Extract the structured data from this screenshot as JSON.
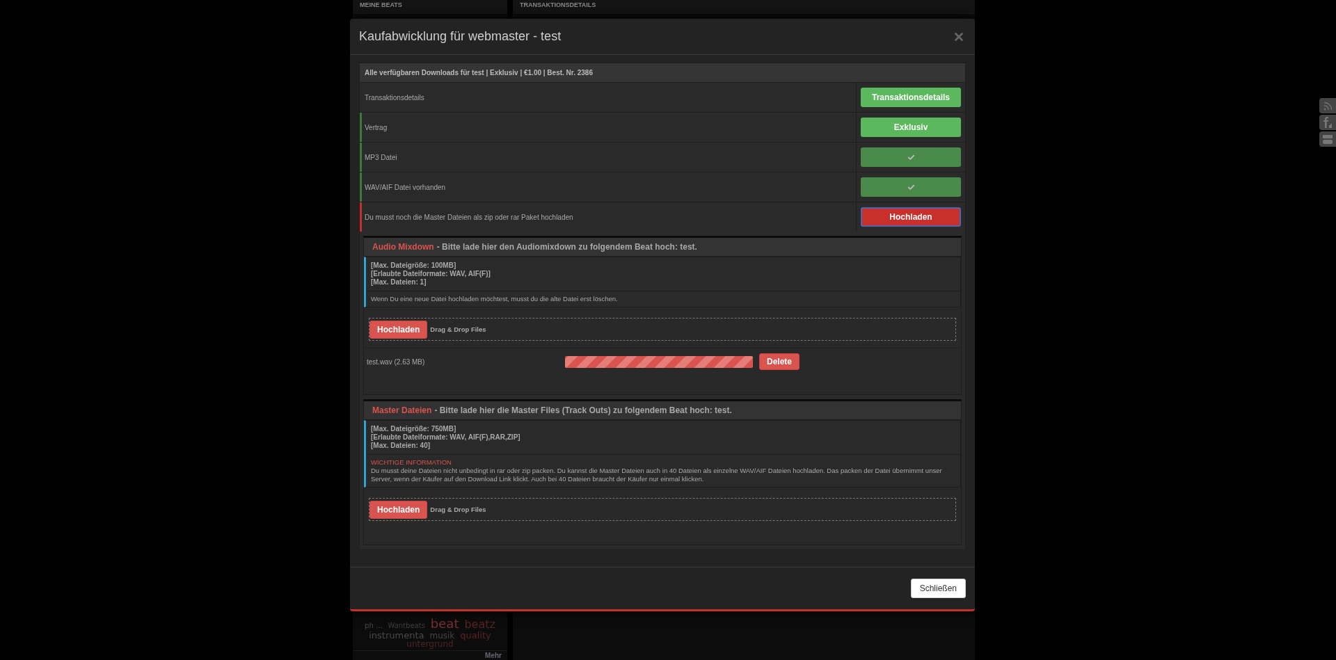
{
  "background": {
    "left_header": "MEINE BEATS",
    "right_header": "TRANSAKTIONSDETAILS",
    "tags": [
      {
        "text": "ph ...",
        "kind": "small",
        "color": "#4a4a4a"
      },
      {
        "text": "Wantbeats",
        "kind": "small",
        "color": "#3f3f3f"
      },
      {
        "text": "beat",
        "kind": "huge",
        "color": "#7a3030"
      },
      {
        "text": "beatz",
        "kind": "big",
        "color": "#5a2222"
      },
      {
        "text": "instrumenta",
        "kind": "medium",
        "color": "#4a4a4a"
      },
      {
        "text": "musik",
        "kind": "normal",
        "color": "#444444"
      },
      {
        "text": "quality",
        "kind": "medium",
        "color": "#5a2222"
      },
      {
        "text": "untergrund",
        "kind": "normal",
        "color": "#4f2424"
      }
    ],
    "more_link": "Mehr"
  },
  "modal": {
    "title": "Kaufabwicklung für webmaster - test",
    "summary": "Alle verfügbaren Downloads für test | Exklusiv | €1.00 | Best. Nr. 2386",
    "rows": [
      {
        "label": "Transaktionsdetails",
        "button": {
          "kind": "primary",
          "text": "Transaktionsdetails"
        }
      },
      {
        "label": "Vertrag",
        "color": "#3c7a3c",
        "button": {
          "kind": "primary",
          "text": "Exklusiv"
        }
      },
      {
        "label": "MP3 Datei",
        "color": "#3c7a3c",
        "button": {
          "kind": "done"
        }
      },
      {
        "label": "WAV/AIF Datei vorhanden",
        "color": "#3c7a3c",
        "button": {
          "kind": "done"
        }
      },
      {
        "label": "Du musst noch die Master Dateien als zip oder rar Paket hochladen",
        "color": "#c9302c",
        "button": {
          "kind": "danger",
          "text": "Hochladen"
        }
      }
    ],
    "sections": [
      {
        "title": "Audio Mixdown",
        "subtitle": "- Bitte lade hier den Audiomixdown zu folgendem Beat hoch: test.",
        "limits": [
          "[Max. Dateigröße: 100MB]",
          "[Erlaubte Dateiformate: WAV, AIF(F)]",
          "[Max. Dateien: 1]"
        ],
        "notice": {
          "text": "Wenn Du eine neue Datei hochladen möchtest, musst du die alte Datei erst löschen."
        },
        "upload_button": "Hochladen",
        "drop_hint": "Drag & Drop Files",
        "files": [
          {
            "name": "test.wav (2.63 MB)",
            "level": 1,
            "delete": "Delete"
          }
        ]
      },
      {
        "title": "Master Dateien",
        "subtitle": "- Bitte lade hier die Master Files (Track Outs) zu folgendem Beat hoch: test.",
        "limits": [
          "[Max. Dateigröße: 750MB]",
          "[Erlaubte Dateiformate: WAV, AIF(F),RAR,ZIP]",
          "[Max. Dateien: 40]"
        ],
        "notice": {
          "heading": "WICHTIGE INFORMATION",
          "text": "Du musst deine Dateien nicht unbedingt in rar oder zip packen. Du kannst die Master Dateien auch in 40 Dateien als einzelne WAV/AIF Dateien hochladen. Das packen der Datei übernimmt unser Server, wenn der Käufer auf den Download Link klickt. Auch bei 40 Dateien braucht der Käufer nur einmal klicken."
        },
        "upload_button": "Hochladen",
        "drop_hint": "Drag & Drop Files"
      }
    ],
    "close_button": "Schließen"
  }
}
